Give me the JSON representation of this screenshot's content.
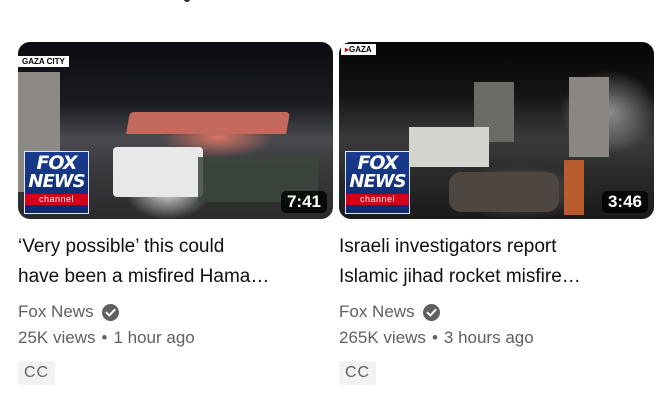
{
  "videos": [
    {
      "location_tag": "GAZA CITY",
      "logo": {
        "top": "FOX",
        "mid": "NEWS",
        "bottom": "channel"
      },
      "duration": "7:41",
      "title_line1": "‘Very possible’ this could",
      "title_line2": "have been a misfired Hama…",
      "channel": "Fox News",
      "views": "25K views",
      "time": "1 hour ago",
      "badge": "CC"
    },
    {
      "location_tag": "GAZA",
      "logo": {
        "top": "FOX",
        "mid": "NEWS",
        "bottom": "channel"
      },
      "duration": "3:46",
      "title_line1": "Israeli investigators report",
      "title_line2": "Islamic jihad rocket misfire…",
      "channel": "Fox News",
      "views": "265K views",
      "time": "3 hours ago",
      "badge": "CC"
    }
  ],
  "separator": "•",
  "icons": {
    "verified": "check-circle-icon"
  }
}
